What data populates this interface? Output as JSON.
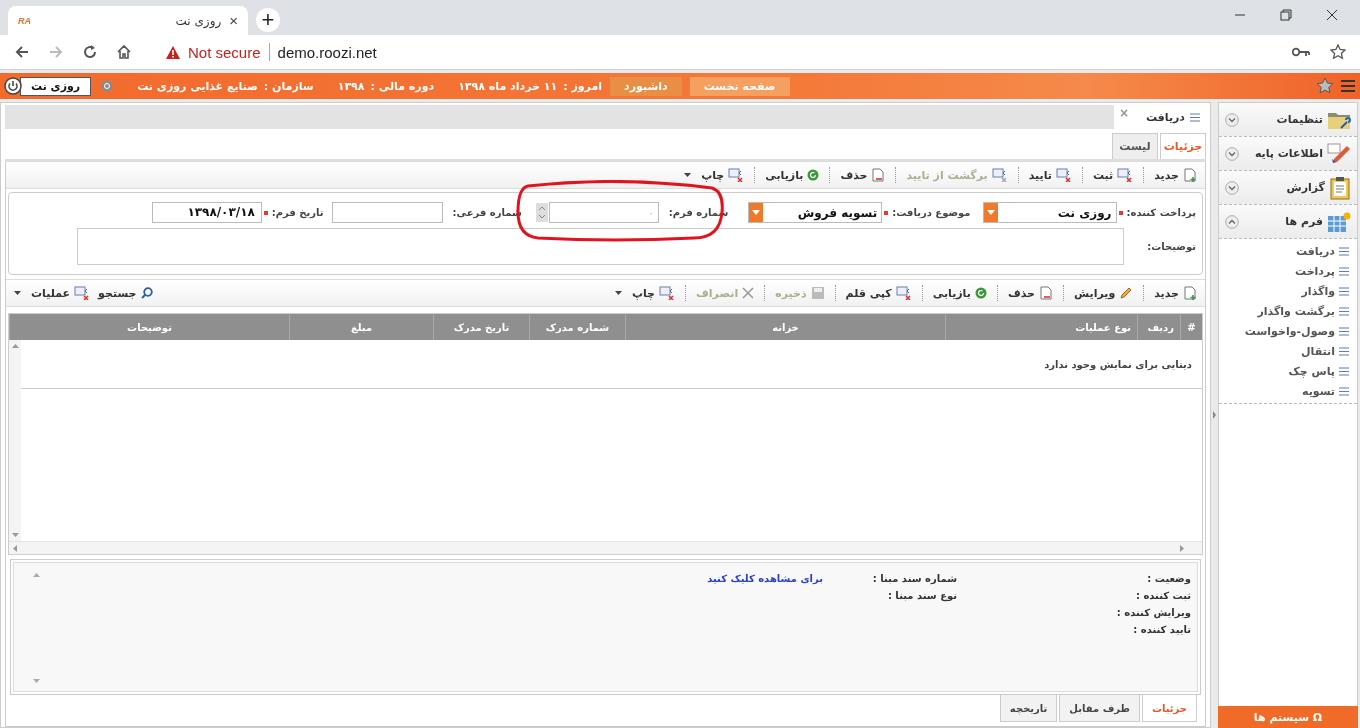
{
  "browser": {
    "favicon": "RA",
    "tab_title": "روزی نت",
    "close": "×",
    "new_tab": "+",
    "security": "Not secure",
    "url": "demo.roozi.net"
  },
  "topbar": {
    "buttons": [
      {
        "label": "صفحه نخست",
        "selected": false
      },
      {
        "label": "داشبورد",
        "selected": true
      }
    ],
    "info": [
      {
        "label": "امروز :",
        "value": "۱۱ خرداد ماه ۱۳۹۸"
      },
      {
        "label": "دوره مالی :",
        "value": "۱۳۹۸"
      },
      {
        "label": "سازمان :",
        "value": "صنایع غذایی روزی نت"
      }
    ],
    "user_button": "روزی نت"
  },
  "page_tab": {
    "title": "دریافت",
    "close": "×"
  },
  "view_tabs": [
    {
      "label": "جزئیات",
      "selected": true
    },
    {
      "label": "لیست",
      "selected": false
    }
  ],
  "toolbar": [
    {
      "label": "جدید",
      "kind": "new",
      "disabled": false,
      "dropdown": false
    },
    {
      "label": "ثبت",
      "kind": "form",
      "disabled": false,
      "dropdown": false
    },
    {
      "label": "تایید",
      "kind": "form",
      "disabled": false,
      "dropdown": false
    },
    {
      "label": "برگشت از تایید",
      "kind": "form",
      "disabled": true,
      "dropdown": false
    },
    {
      "label": "حذف",
      "kind": "delete",
      "disabled": false,
      "dropdown": false
    },
    {
      "label": "بازیابی",
      "kind": "refresh",
      "disabled": false,
      "dropdown": false
    },
    {
      "label": "چاپ",
      "kind": "form",
      "disabled": false,
      "dropdown": true
    }
  ],
  "form": {
    "fields": [
      {
        "label": "پرداخت کننده:",
        "required": true,
        "kind": "select",
        "value": "روزی نت"
      },
      {
        "label": "موضوع دریافت:",
        "required": true,
        "kind": "select",
        "value": "تسویه فروش"
      },
      {
        "label": "شماره فرم:",
        "required": false,
        "kind": "spinner",
        "placeholder": "۰",
        "highlighted": true
      },
      {
        "label": "شماره فرعی:",
        "required": false,
        "kind": "text"
      },
      {
        "label": "تاریخ فرم:",
        "required": true,
        "kind": "text",
        "value": "۱۳۹۸/۰۳/۱۸"
      }
    ],
    "description_label": "توضیحات:"
  },
  "grid_toolbar": [
    {
      "label": "جدید",
      "kind": "new",
      "disabled": false,
      "dropdown": false
    },
    {
      "label": "ویرایش",
      "kind": "edit",
      "disabled": false,
      "dropdown": false
    },
    {
      "label": "حذف",
      "kind": "delete",
      "disabled": false,
      "dropdown": false
    },
    {
      "label": "بازیابی",
      "kind": "refresh",
      "disabled": false,
      "dropdown": false
    },
    {
      "label": "کپی قلم",
      "kind": "form",
      "disabled": false,
      "dropdown": false
    },
    {
      "label": "ذخیره",
      "kind": "save",
      "disabled": true,
      "dropdown": false
    },
    {
      "label": "انصراف",
      "kind": "cancel",
      "disabled": true,
      "dropdown": false
    },
    {
      "label": "چاپ",
      "kind": "form",
      "disabled": false,
      "dropdown": true
    }
  ],
  "grid_tools": [
    {
      "label": "جستجو",
      "kind": "search",
      "dropdown": false
    },
    {
      "label": "عملیات",
      "kind": "form",
      "dropdown": true
    }
  ],
  "table": {
    "columns": [
      "#",
      "ردیف",
      "نوع عملیات",
      "خزانه",
      "شماره مدرک",
      "تاریخ مدرک",
      "مبلغ",
      "توضیحات"
    ],
    "empty_text": "دیتایی برای نمایش وجود ندارد"
  },
  "details": {
    "labels": [
      "وضعیت :",
      "ثبت کننده :",
      "ویرایش کننده :",
      "تایید کننده :"
    ],
    "source_number_label": "شماره سند مبنا :",
    "source_link": "برای مشاهده کلیک کنید",
    "source_type_label": "نوع سند مبنا :"
  },
  "bottom_tabs": [
    {
      "label": "جزئیات",
      "selected": true
    },
    {
      "label": "طرف مقابل",
      "selected": false
    },
    {
      "label": "تاریخچه",
      "selected": false
    }
  ],
  "sidebar": {
    "groups": [
      {
        "label": "تنظیمات",
        "kind": "settings",
        "expanded": false
      },
      {
        "label": "اطلاعات پایه",
        "kind": "base",
        "expanded": false
      },
      {
        "label": "گزارش",
        "kind": "report",
        "expanded": false
      },
      {
        "label": "فرم ها",
        "kind": "forms",
        "expanded": true,
        "children": [
          {
            "label": "دریافت"
          },
          {
            "label": "پرداخت"
          },
          {
            "label": "واگذار"
          },
          {
            "label": "برگشت واگذار"
          },
          {
            "label": "وصول-واخواست"
          },
          {
            "label": "انتقال"
          },
          {
            "label": "پاس چک"
          },
          {
            "label": "تسویه"
          }
        ]
      }
    ],
    "system_button": {
      "icon": "Ω",
      "label": "سیستم ها"
    }
  }
}
